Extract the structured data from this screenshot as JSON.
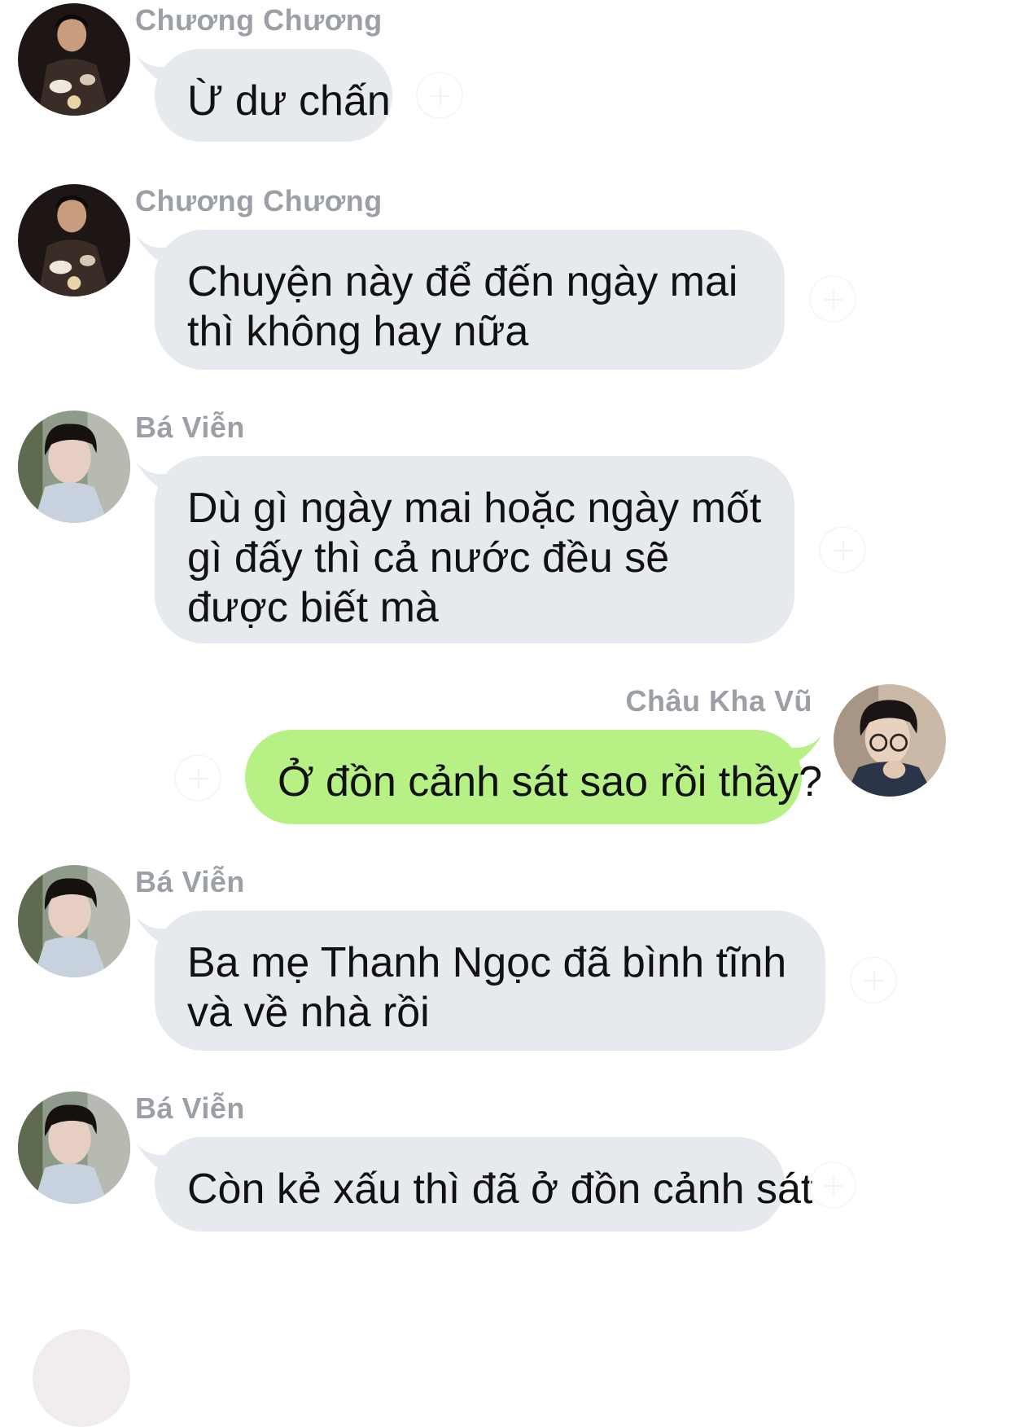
{
  "messages": [
    {
      "sender": "Chương Chương",
      "text": "Ừ dư chấn",
      "direction": "in"
    },
    {
      "sender": "Chương Chương",
      "text": "Chuyện này để đến ngày mai thì không hay nữa",
      "direction": "in"
    },
    {
      "sender": "Bá Viễn",
      "text": "Dù gì ngày mai hoặc ngày mốt gì đấy thì cả nước đều sẽ được biết mà",
      "direction": "in"
    },
    {
      "sender": "Châu Kha Vũ",
      "text": "Ở đồn cảnh sát sao rồi thầy?",
      "direction": "out"
    },
    {
      "sender": "Bá Viễn",
      "text": "Ba mẹ Thanh Ngọc đã bình tĩnh và về nhà rồi",
      "direction": "in"
    },
    {
      "sender": "Bá Viễn",
      "text": "Còn kẻ xấu thì đã ở đồn cảnh sát",
      "direction": "in"
    }
  ],
  "colors": {
    "incoming_bubble": "#e6e9ed",
    "outgoing_bubble": "#b7f085",
    "sender_name": "#9b9fa6"
  },
  "icons": {
    "reaction": "add-reaction-icon"
  }
}
